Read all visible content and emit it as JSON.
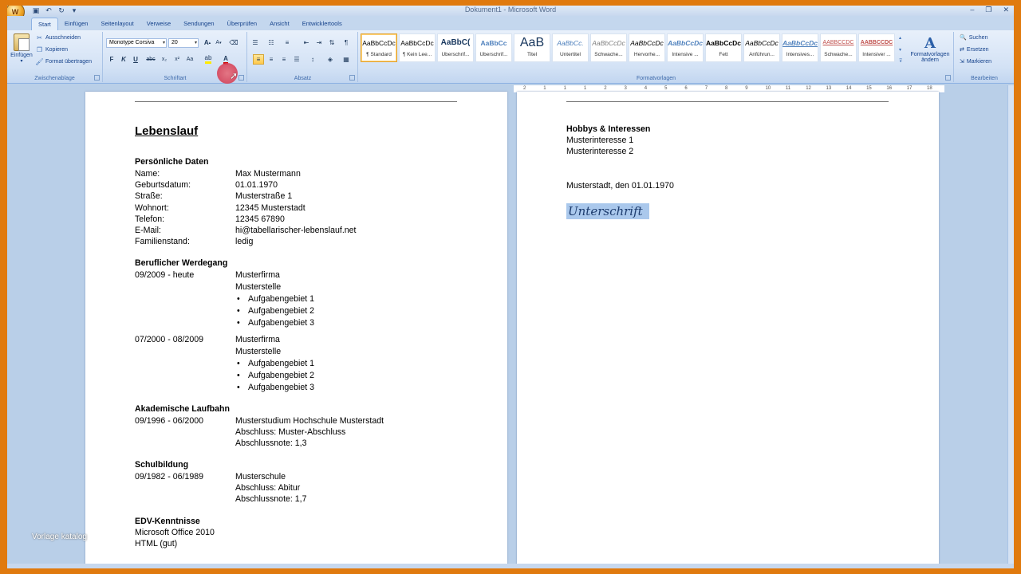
{
  "window": {
    "title": "Dokument1 - Microsoft Word",
    "minimize": "–",
    "restore": "❐",
    "close": "✕"
  },
  "qat": [
    "save-icon",
    "undo-icon",
    "redo-icon",
    "customize-icon"
  ],
  "tabs": [
    "Start",
    "Einfügen",
    "Seitenlayout",
    "Verweise",
    "Sendungen",
    "Überprüfen",
    "Ansicht",
    "Entwicklertools"
  ],
  "clipboard": {
    "paste": "Einfügen",
    "cut": "Ausschneiden",
    "copy": "Kopieren",
    "format_painter": "Format übertragen",
    "label": "Zwischenablage"
  },
  "font": {
    "family": "Monotype Corsiva",
    "size": "20",
    "label": "Schriftart",
    "bold": "F",
    "italic": "K",
    "underline": "U",
    "strike": "abc",
    "subscript": "x₂",
    "superscript": "x²",
    "case": "Aa",
    "font_color": "A",
    "grow": "A",
    "shrink": "A"
  },
  "paragraph": {
    "label": "Absatz",
    "pilcrow": "¶"
  },
  "styles": {
    "label": "Formatvorlagen",
    "items": [
      {
        "sample": "AaBbCcDc",
        "name": "¶ Standard",
        "active": true
      },
      {
        "sample": "AaBbCcDc",
        "name": "¶ Kein Lee...",
        "active": false
      },
      {
        "sample": "AaBbC(",
        "name": "Überschrif...",
        "active": false
      },
      {
        "sample": "AaBbCc",
        "name": "Überschrif...",
        "active": false
      },
      {
        "sample": "AaB",
        "name": "Titel",
        "active": false
      },
      {
        "sample": "AaBbCc.",
        "name": "Untertitel",
        "active": false
      },
      {
        "sample": "AaBbCcDc",
        "name": "Schwache...",
        "active": false
      },
      {
        "sample": "AaBbCcDc",
        "name": "Hervorhe...",
        "active": false
      },
      {
        "sample": "AaBbCcDc",
        "name": "Intensive ...",
        "active": false
      },
      {
        "sample": "AaBbCcDc",
        "name": "Fett",
        "active": false
      },
      {
        "sample": "AaBbCcDc",
        "name": "Anführun...",
        "active": false
      },
      {
        "sample": "AaBbCcDc",
        "name": "Intensives...",
        "active": false
      },
      {
        "sample": "AABBCCDC",
        "name": "Schwache...",
        "active": false
      },
      {
        "sample": "AABBCCDC",
        "name": "Intensiver ...",
        "active": false
      }
    ],
    "change": "Formatvorlagen ändern"
  },
  "editing": {
    "label": "Bearbeiten",
    "find": "Suchen",
    "replace": "Ersetzen",
    "select": "Markieren"
  },
  "ruler_ticks": [
    "2",
    "1",
    "1",
    "1",
    "2",
    "3",
    "4",
    "5",
    "6",
    "7",
    "8",
    "9",
    "10",
    "11",
    "12",
    "13",
    "14",
    "15",
    "16",
    "17",
    "18"
  ],
  "cv": {
    "title": "Lebenslauf",
    "personal": {
      "heading": "Persönliche Daten",
      "rows": [
        {
          "label": "Name:",
          "value": "Max Mustermann"
        },
        {
          "label": "Geburtsdatum:",
          "value": "01.01.1970"
        },
        {
          "label": "Straße:",
          "value": "Musterstraße 1"
        },
        {
          "label": "Wohnort:",
          "value": "12345 Musterstadt"
        },
        {
          "label": "Telefon:",
          "value": "12345 67890"
        },
        {
          "label": "E-Mail:",
          "value": "hi@tabellarischer-lebenslauf.net"
        },
        {
          "label": "Familienstand:",
          "value": "ledig"
        }
      ]
    },
    "career": {
      "heading": "Beruflicher Werdegang",
      "jobs": [
        {
          "period": "09/2009 - heute",
          "company": "Musterfirma",
          "position": "Musterstelle",
          "tasks": [
            "Aufgabengebiet 1",
            "Aufgabengebiet 2",
            "Aufgabengebiet 3"
          ]
        },
        {
          "period": "07/2000 - 08/2009",
          "company": "Musterfirma",
          "position": "Musterstelle",
          "tasks": [
            "Aufgabengebiet 1",
            "Aufgabengebiet 2",
            "Aufgabengebiet 3"
          ]
        }
      ]
    },
    "academic": {
      "heading": "Akademische Laufbahn",
      "period": "09/1996 - 06/2000",
      "lines": [
        "Musterstudium Hochschule Musterstadt",
        "Abschluss: Muster-Abschluss",
        "Abschlussnote: 1,3"
      ]
    },
    "school": {
      "heading": "Schulbildung",
      "period": "09/1982 - 06/1989",
      "lines": [
        "Musterschule",
        "Abschluss: Abitur",
        "Abschlussnote: 1,7"
      ]
    },
    "it": {
      "heading": "EDV-Kenntnisse",
      "lines": [
        "Microsoft Office 2010",
        "HTML (gut)"
      ]
    },
    "hobbies": {
      "heading": "Hobbys & Interessen",
      "lines": [
        "Musterinteresse 1",
        "Musterinteresse 2"
      ]
    },
    "place_date": "Musterstadt, den 01.01.1970",
    "signature": "Unterschrift"
  },
  "watermark": "Vorlage katalog"
}
